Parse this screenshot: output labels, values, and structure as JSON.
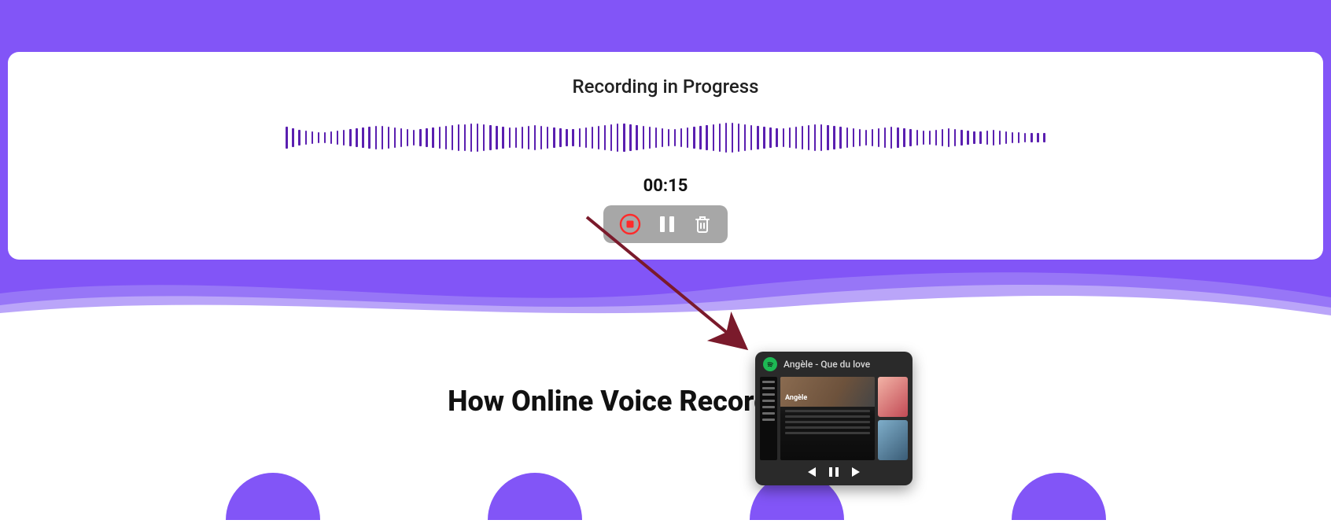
{
  "recorder": {
    "title": "Recording in Progress",
    "timer": "00:15"
  },
  "section": {
    "heading": "How Online Voice Recorder Works"
  },
  "popup": {
    "title": "Angèle - Que du love",
    "artist": "Angèle"
  }
}
